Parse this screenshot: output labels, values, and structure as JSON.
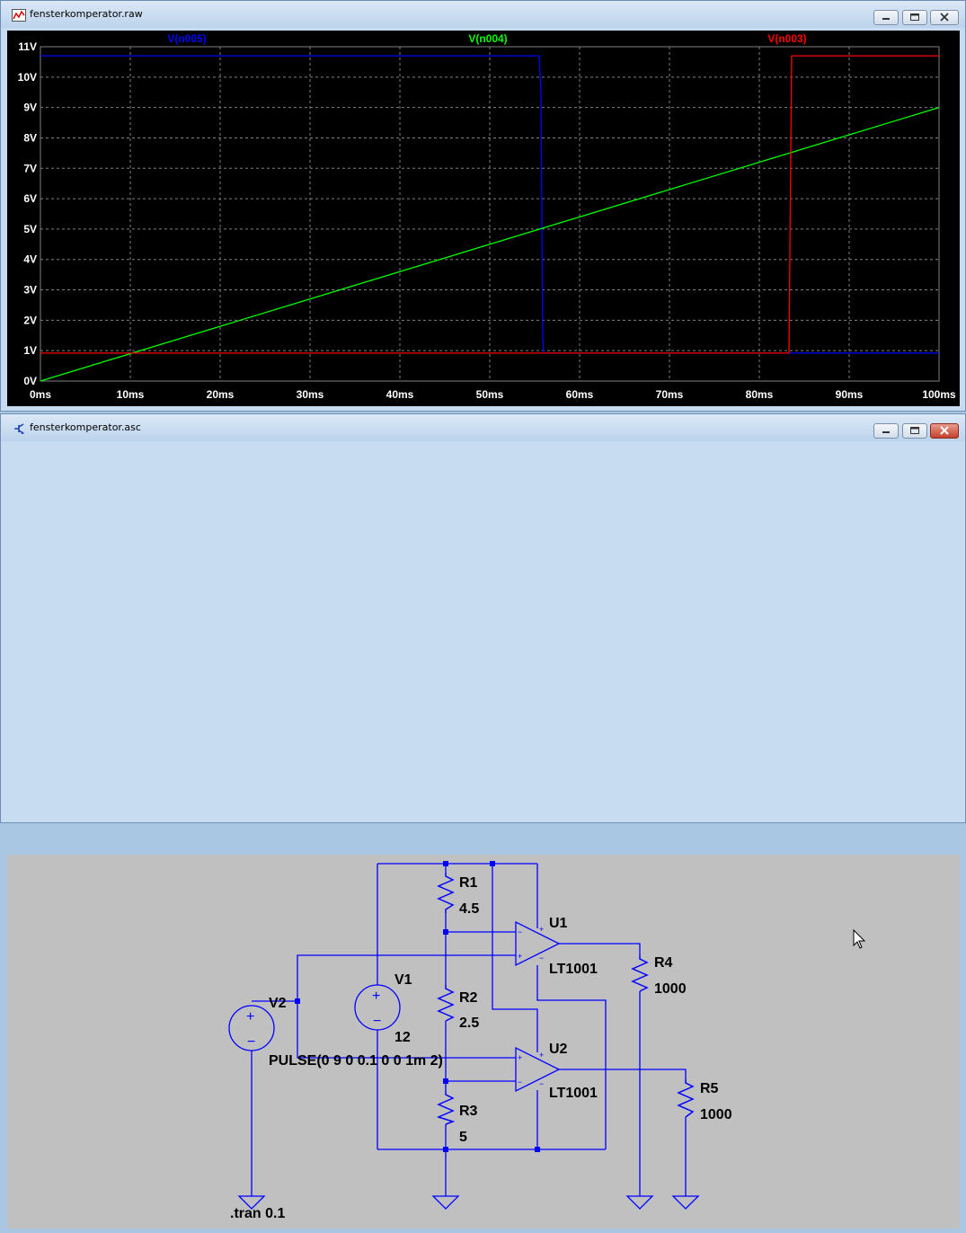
{
  "plot_window": {
    "title": "fensterkomperator.raw"
  },
  "schematic_window": {
    "title": "fensterkomperator.asc"
  },
  "colors": {
    "n005": "#0000ff",
    "n004": "#00ff00",
    "n003": "#ff0000",
    "grid": "#808080",
    "axis_text": "#ffffff",
    "wire": "#0000ff",
    "schematic_bg": "#c0c0c0"
  },
  "chart_data": {
    "type": "line",
    "title": "",
    "xlabel": "",
    "ylabel": "",
    "xlim": [
      0,
      100
    ],
    "ylim": [
      0,
      11
    ],
    "grid": true,
    "legend": "top",
    "x_ticks": [
      "0ms",
      "10ms",
      "20ms",
      "30ms",
      "40ms",
      "50ms",
      "60ms",
      "70ms",
      "80ms",
      "90ms",
      "100ms"
    ],
    "y_ticks": [
      "0V",
      "1V",
      "2V",
      "3V",
      "4V",
      "5V",
      "6V",
      "7V",
      "8V",
      "9V",
      "10V",
      "11V"
    ],
    "series": [
      {
        "name": "V(n005)",
        "x": [
          0,
          55.5,
          55.7,
          55.9,
          56.0,
          100
        ],
        "y": [
          10.7,
          10.7,
          9.5,
          1.4,
          0.92,
          0.92
        ]
      },
      {
        "name": "V(n004)",
        "x": [
          0,
          100
        ],
        "y": [
          0,
          9
        ]
      },
      {
        "name": "V(n003)",
        "x": [
          0,
          83.3,
          83.6,
          100
        ],
        "y": [
          0.92,
          0.92,
          10.7,
          10.7
        ]
      }
    ]
  },
  "schematic": {
    "r1": {
      "name": "R1",
      "value": "4.5"
    },
    "r2": {
      "name": "R2",
      "value": "2.5"
    },
    "r3": {
      "name": "R3",
      "value": "5"
    },
    "r4": {
      "name": "R4",
      "value": "1000"
    },
    "r5": {
      "name": "R5",
      "value": "1000"
    },
    "u1": {
      "name": "U1",
      "model": "LT1001"
    },
    "u2": {
      "name": "U2",
      "model": "LT1001"
    },
    "v1": {
      "name": "V1",
      "value": "12"
    },
    "v2": {
      "name": "V2",
      "value": "PULSE(0 9 0 0.1 0 0 1m 2)"
    },
    "directive": ".tran 0.1"
  }
}
